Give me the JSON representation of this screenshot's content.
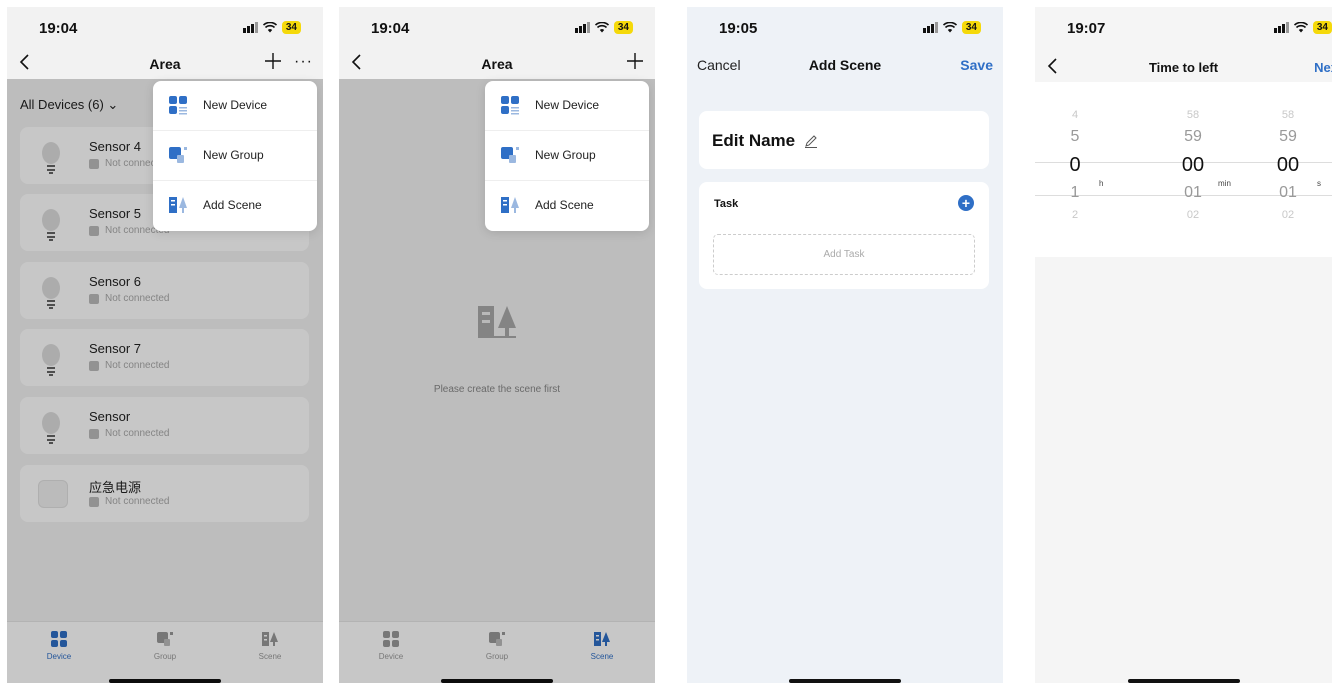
{
  "status": {
    "time1": "19:04",
    "time2": "19:04",
    "time3": "19:05",
    "time4": "19:07",
    "battery": "34"
  },
  "screen1": {
    "title": "Area",
    "filter": "All Devices (6) ⌄",
    "devices": [
      {
        "name": "Sensor 4",
        "status": "Not connected",
        "icon": "bulb-icon"
      },
      {
        "name": "Sensor 5",
        "status": "Not connected",
        "icon": "bulb-icon"
      },
      {
        "name": "Sensor 6",
        "status": "Not connected",
        "icon": "bulb-icon"
      },
      {
        "name": "Sensor 7",
        "status": "Not connected",
        "icon": "bulb-icon"
      },
      {
        "name": "Sensor",
        "status": "Not connected",
        "icon": "bulb-icon"
      },
      {
        "name": "应急电源",
        "status": "Not connected",
        "icon": "box-icon"
      }
    ]
  },
  "menu": {
    "items": [
      "New Device",
      "New Group",
      "Add Scene"
    ]
  },
  "tabs": [
    "Device",
    "Group",
    "Scene"
  ],
  "screen2": {
    "title": "Area",
    "empty_text": "Please create the scene first"
  },
  "screen3": {
    "cancel": "Cancel",
    "title": "Add Scene",
    "save": "Save",
    "name": "Edit Name",
    "task_header": "Task",
    "add_task": "Add Task"
  },
  "screen4": {
    "title": "Time to left",
    "next": "Nex",
    "hours": [
      "4",
      "5",
      "0",
      "1",
      "2"
    ],
    "minutes": [
      "58",
      "59",
      "00",
      "01",
      "02"
    ],
    "seconds": [
      "58",
      "59",
      "00",
      "01",
      "02"
    ],
    "unit_h": "h",
    "unit_min": "min",
    "unit_s": "s"
  },
  "colors": {
    "accent": "#2f6fc6",
    "battery": "#f5d90a"
  }
}
